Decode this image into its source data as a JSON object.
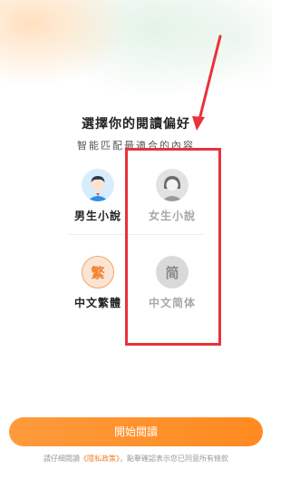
{
  "header": {
    "title": "選擇你的閱讀偏好",
    "subtitle": "智能匹配最適合的內容"
  },
  "options": {
    "male": {
      "label": "男生小說",
      "icon": "boy-avatar-icon",
      "selected": true
    },
    "female": {
      "label": "女生小說",
      "icon": "girl-avatar-icon",
      "selected": false
    },
    "traditional": {
      "label": "中文繁體",
      "glyph": "繁",
      "selected": true
    },
    "simplified": {
      "label": "中文简体",
      "glyph": "简",
      "selected": false
    }
  },
  "actions": {
    "start_label": "開始閱讀"
  },
  "footer": {
    "prefix": "請仔細閱讀",
    "policy": "《隱私政策》",
    "suffix": "，點擊確認表示您已同意所有條款"
  },
  "colors": {
    "accent": "#ff8a1f",
    "annotation": "#e8323c",
    "muted": "#a8a8a8"
  }
}
